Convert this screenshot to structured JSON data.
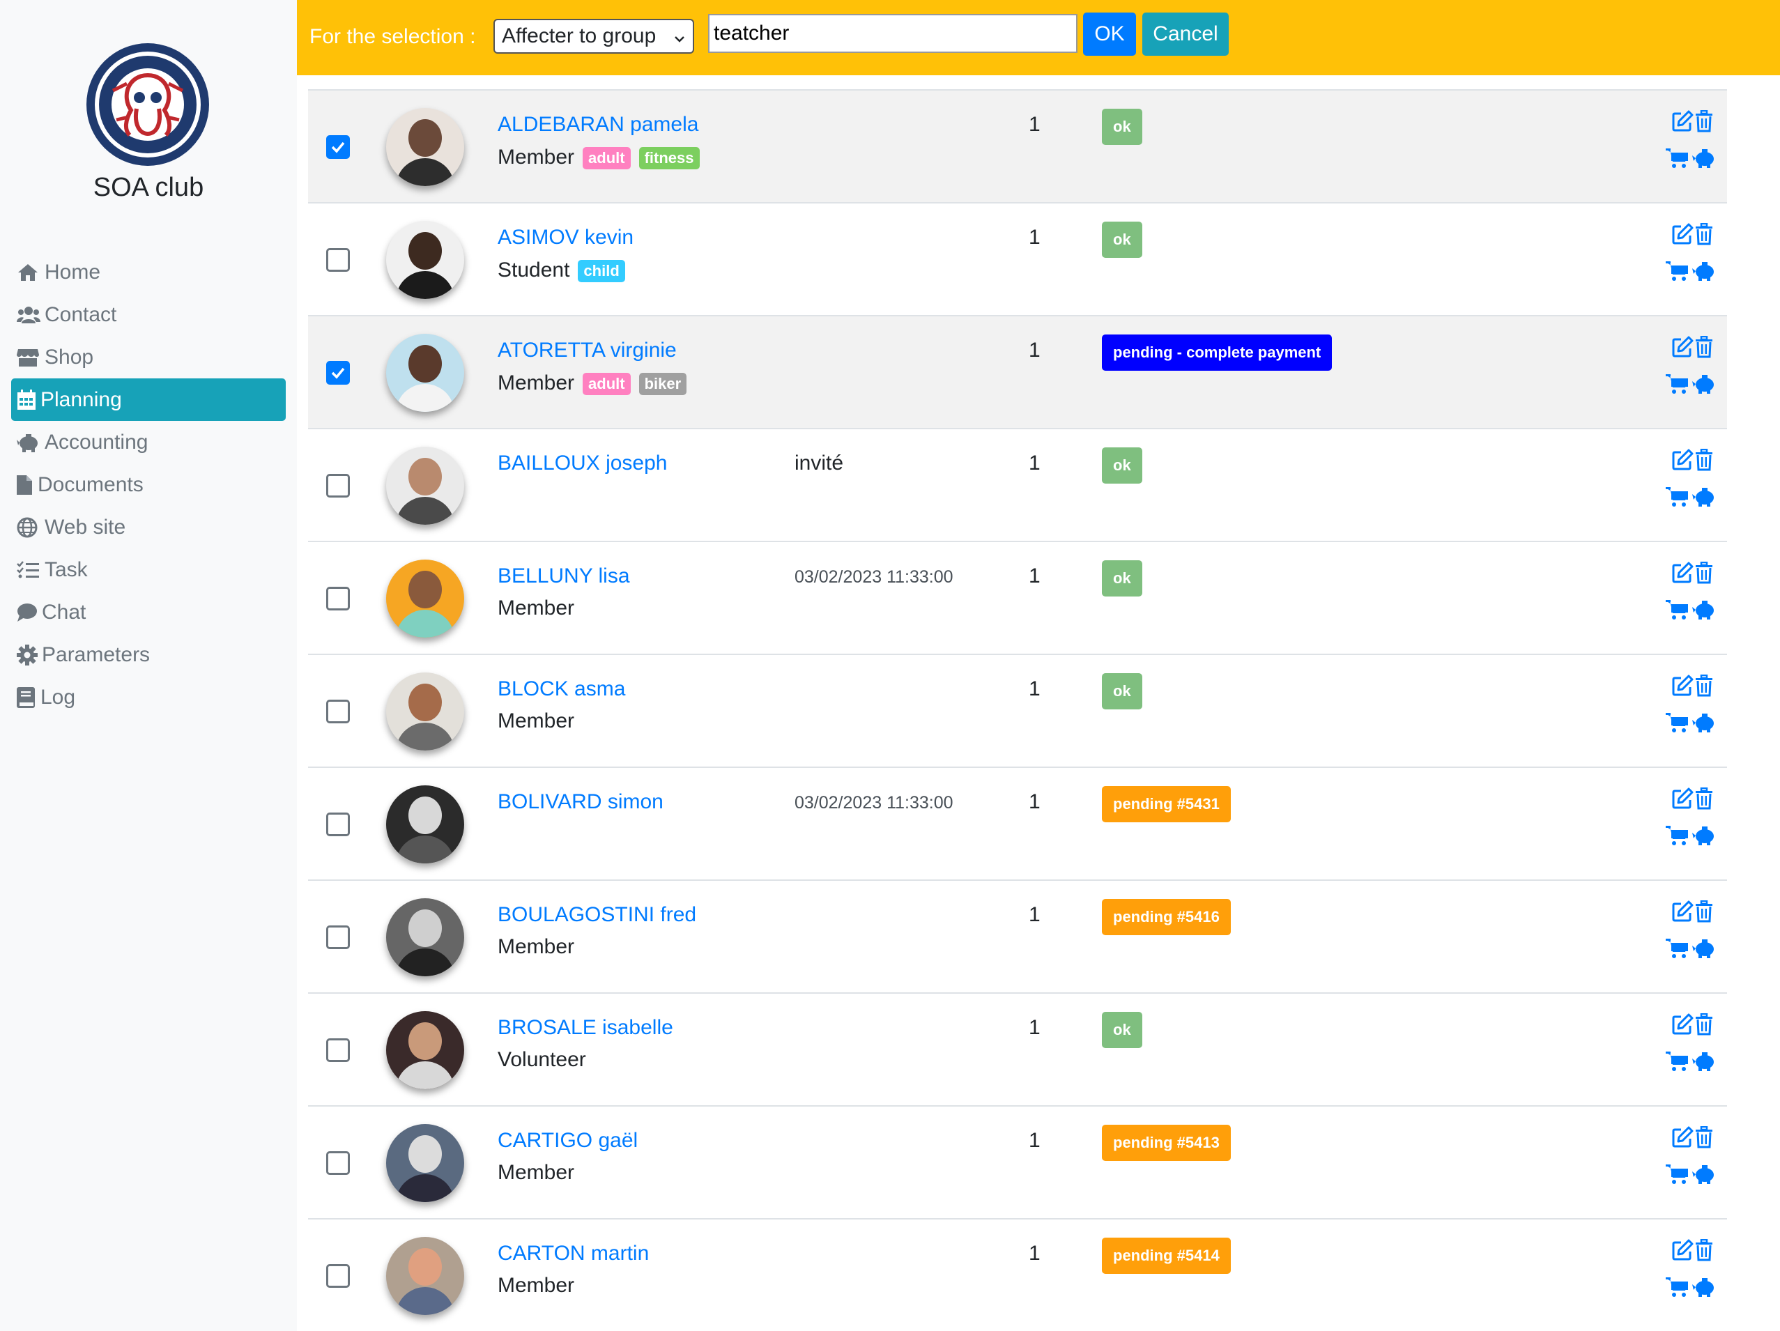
{
  "sidebar": {
    "logo_icon": "dive-club-logo",
    "club_name": "SOA club",
    "items": [
      {
        "label": "Home",
        "icon": "home-icon"
      },
      {
        "label": "Contact",
        "icon": "users-icon"
      },
      {
        "label": "Shop",
        "icon": "store-icon"
      },
      {
        "label": "Planning",
        "icon": "calendar-icon",
        "active": true
      },
      {
        "label": "Accounting",
        "icon": "piggy-bank-icon"
      },
      {
        "label": "Documents",
        "icon": "file-icon"
      },
      {
        "label": "Web site",
        "icon": "globe-icon"
      },
      {
        "label": "Task",
        "icon": "tasks-icon"
      },
      {
        "label": "Chat",
        "icon": "comment-icon"
      },
      {
        "label": "Parameters",
        "icon": "gear-icon"
      },
      {
        "label": "Log",
        "icon": "book-icon"
      }
    ]
  },
  "action_bar": {
    "label": "For the selection :",
    "select_value": "Affecter to group",
    "input_value": "teatcher",
    "ok_label": "OK",
    "cancel_label": "Cancel"
  },
  "colors": {
    "accent": "#007bff",
    "active_nav": "#17a2b8",
    "action_bar": "#ffc107",
    "status_ok": "#7fbf7f",
    "status_pending": "#ff9f0a",
    "status_pending_payment": "#0000ff",
    "tag_adult": "#ff80c0",
    "tag_fitness": "#7ccf5f",
    "tag_child": "#33ccff",
    "tag_biker": "#a0a0a0"
  },
  "members": [
    {
      "checked": true,
      "name": "ALDEBARAN pamela",
      "role": "Member",
      "tags": [
        {
          "label": "adult",
          "color": "#ff80c0"
        },
        {
          "label": "fitness",
          "color": "#7ccf5f"
        }
      ],
      "extra": "",
      "qty": "1",
      "status": "ok",
      "status_color": "#7fbf7f"
    },
    {
      "checked": false,
      "name": "ASIMOV kevin",
      "role": "Student",
      "tags": [
        {
          "label": "child",
          "color": "#33ccff"
        }
      ],
      "extra": "",
      "qty": "1",
      "status": "ok",
      "status_color": "#7fbf7f"
    },
    {
      "checked": true,
      "name": "ATORETTA virginie",
      "role": "Member",
      "tags": [
        {
          "label": "adult",
          "color": "#ff80c0"
        },
        {
          "label": "biker",
          "color": "#a0a0a0"
        }
      ],
      "extra": "",
      "qty": "1",
      "status": "pending - complete payment",
      "status_color": "#0000ff"
    },
    {
      "checked": false,
      "name": "BAILLOUX joseph",
      "role": "",
      "tags": [],
      "extra": "invité",
      "qty": "1",
      "status": "ok",
      "status_color": "#7fbf7f"
    },
    {
      "checked": false,
      "name": "BELLUNY lisa",
      "role": "Member",
      "tags": [],
      "extra": "03/02/2023 11:33:00",
      "qty": "1",
      "status": "ok",
      "status_color": "#7fbf7f"
    },
    {
      "checked": false,
      "name": "BLOCK asma",
      "role": "Member",
      "tags": [],
      "extra": "",
      "qty": "1",
      "status": "ok",
      "status_color": "#7fbf7f"
    },
    {
      "checked": false,
      "name": "BOLIVARD simon",
      "role": "",
      "tags": [],
      "extra": "03/02/2023 11:33:00",
      "qty": "1",
      "status": "pending #5431",
      "status_color": "#ff9f0a"
    },
    {
      "checked": false,
      "name": "BOULAGOSTINI fred",
      "role": "Member",
      "tags": [],
      "extra": "",
      "qty": "1",
      "status": "pending #5416",
      "status_color": "#ff9f0a"
    },
    {
      "checked": false,
      "name": "BROSALE isabelle",
      "role": "Volunteer",
      "tags": [],
      "extra": "",
      "qty": "1",
      "status": "ok",
      "status_color": "#7fbf7f"
    },
    {
      "checked": false,
      "name": "CARTIGO gaël",
      "role": "Member",
      "tags": [],
      "extra": "",
      "qty": "1",
      "status": "pending #5413",
      "status_color": "#ff9f0a"
    },
    {
      "checked": false,
      "name": "CARTON martin",
      "role": "Member",
      "tags": [],
      "extra": "",
      "qty": "1",
      "status": "pending #5414",
      "status_color": "#ff9f0a"
    }
  ],
  "row_actions": {
    "edit_icon": "edit-icon",
    "delete_icon": "trash-icon",
    "cart_icon": "cart-icon",
    "piggy_icon": "piggy-bank-icon"
  }
}
